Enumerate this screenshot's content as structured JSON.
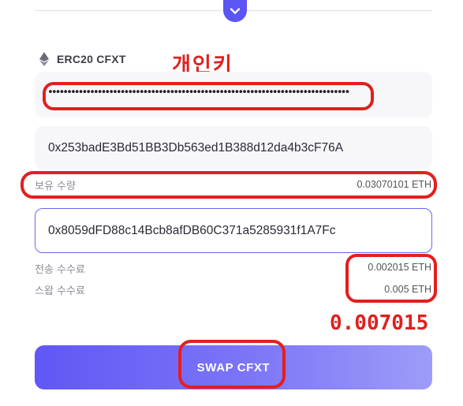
{
  "token": {
    "icon": "ethereum-icon",
    "label": "ERC20 CFXT"
  },
  "annotations": {
    "private_key_note": "개인키",
    "total_fee_note": "0.007015",
    "color": "#e02020"
  },
  "private_key_field": {
    "value": "•••••••••••••••••••••••••••••••••••••••••••••••••••••••••••••••••••••••••••••••"
  },
  "source_address": {
    "value": "0x253badE3Bd51BB3Db563ed1B388d12da4b3cF76A"
  },
  "balance": {
    "label": "보유 수량",
    "value": "0.03070101 ETH"
  },
  "destination_address": {
    "value": "0x8059dFD88c14Bcb8afDB60C371a5285931f1A7Fc"
  },
  "fees": [
    {
      "label": "전송 수수료",
      "value": "0.002015 ETH"
    },
    {
      "label": "스왑 수수료",
      "value": "0.005 ETH"
    }
  ],
  "swap_button": {
    "label": "SWAP CFXT"
  },
  "colors": {
    "accent": "#5b55f4",
    "annotation_red": "#e41e1e"
  }
}
